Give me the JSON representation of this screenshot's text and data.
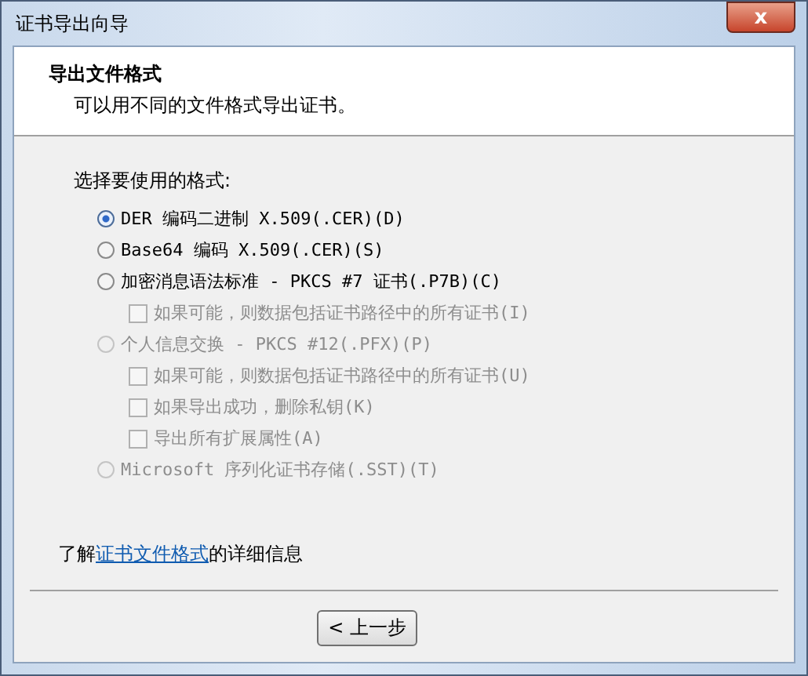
{
  "window": {
    "title": "证书导出向导",
    "close": "x"
  },
  "header": {
    "title": "导出文件格式",
    "subtitle": "可以用不同的文件格式导出证书。"
  },
  "prompt": "选择要使用的格式:",
  "options": [
    {
      "label": "DER 编码二进制 X.509(.CER)(D)",
      "selected": true,
      "disabled": false
    },
    {
      "label": "Base64 编码 X.509(.CER)(S)",
      "selected": false,
      "disabled": false
    },
    {
      "label": "加密消息语法标准 - PKCS #7 证书(.P7B)(C)",
      "selected": false,
      "disabled": false,
      "children": [
        {
          "label": "如果可能，则数据包括证书路径中的所有证书(I)",
          "checked": false,
          "disabled": true
        }
      ]
    },
    {
      "label": "个人信息交换 - PKCS #12(.PFX)(P)",
      "selected": false,
      "disabled": true,
      "children": [
        {
          "label": "如果可能，则数据包括证书路径中的所有证书(U)",
          "checked": false,
          "disabled": true
        },
        {
          "label": "如果导出成功，删除私钥(K)",
          "checked": false,
          "disabled": true
        },
        {
          "label": "导出所有扩展属性(A)",
          "checked": false,
          "disabled": true
        }
      ]
    },
    {
      "label": "Microsoft 序列化证书存储(.SST)(T)",
      "selected": false,
      "disabled": true
    }
  ],
  "info": {
    "before": "了解",
    "link": "证书文件格式",
    "after": "的详细信息"
  },
  "buttons": [
    {
      "label": "< 上一步"
    }
  ]
}
